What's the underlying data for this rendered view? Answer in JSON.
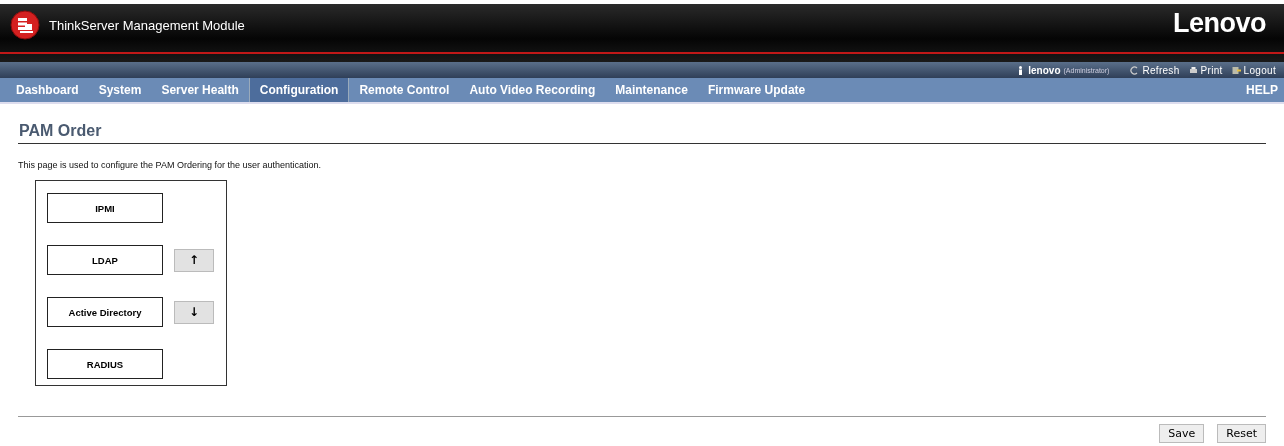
{
  "header": {
    "title": "ThinkServer Management Module",
    "brand": "Lenovo"
  },
  "user_bar": {
    "user": "lenovo",
    "role": "(Administrator)",
    "links": [
      "Refresh",
      "Print",
      "Logout"
    ]
  },
  "nav": [
    {
      "label": "Dashboard",
      "selected": false
    },
    {
      "label": "System",
      "selected": false
    },
    {
      "label": "Server Health",
      "selected": false
    },
    {
      "label": "Configuration",
      "selected": true
    },
    {
      "label": "Remote Control",
      "selected": false
    },
    {
      "label": "Auto Video Recording",
      "selected": false
    },
    {
      "label": "Maintenance",
      "selected": false
    },
    {
      "label": "Firmware Update",
      "selected": false
    }
  ],
  "help": "HELP",
  "page": {
    "title": "PAM Order",
    "description": "This page is used to configure the PAM Ordering for the user authentication."
  },
  "pam_items": [
    "IPMI",
    "LDAP",
    "Active Directory",
    "RADIUS"
  ],
  "move_buttons": [
    "↑",
    "↓"
  ],
  "buttons": [
    "Save",
    "Reset"
  ]
}
